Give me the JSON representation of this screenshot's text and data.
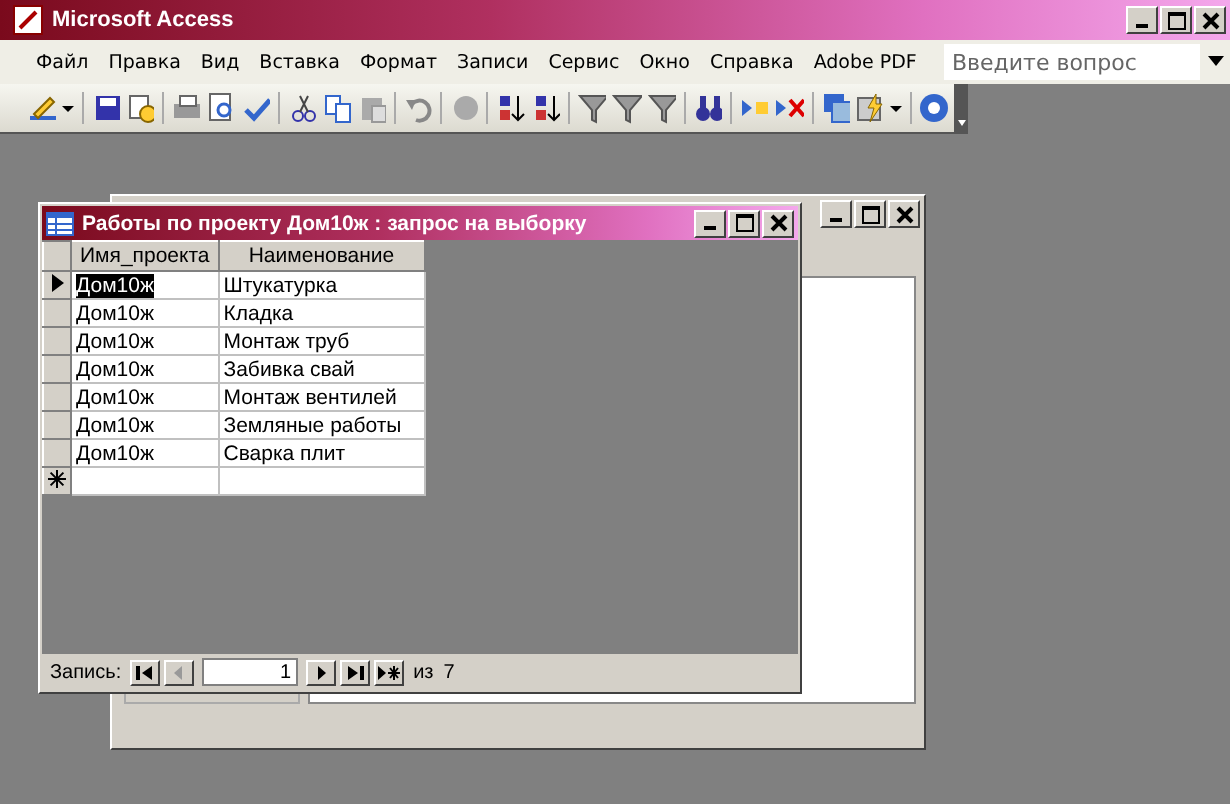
{
  "window": {
    "title": "Microsoft Access"
  },
  "menu": [
    "Файл",
    "Правка",
    "Вид",
    "Вставка",
    "Формат",
    "Записи",
    "Сервис",
    "Окно",
    "Справка",
    "Adobe PDF"
  ],
  "help_box": {
    "placeholder": "Введите вопрос"
  },
  "query_window": {
    "title": "Работы по проекту Дом10ж : запрос на выборку",
    "columns": [
      "Имя_проекта",
      "Наименование"
    ],
    "rows": [
      {
        "cells": [
          "Дом10ж",
          "Штукатурка"
        ],
        "current": true
      },
      {
        "cells": [
          "Дом10ж",
          "Кладка"
        ],
        "current": false
      },
      {
        "cells": [
          "Дом10ж",
          "Монтаж труб"
        ],
        "current": false
      },
      {
        "cells": [
          "Дом10ж",
          "Забивка свай"
        ],
        "current": false
      },
      {
        "cells": [
          "Дом10ж",
          "Монтаж вентилей"
        ],
        "current": false
      },
      {
        "cells": [
          "Дом10ж",
          "Земляные работы"
        ],
        "current": false
      },
      {
        "cells": [
          "Дом10ж",
          "Сварка плит"
        ],
        "current": false
      }
    ],
    "navigator": {
      "label": "Запись:",
      "record": "1",
      "of": "из",
      "total": "7"
    }
  }
}
